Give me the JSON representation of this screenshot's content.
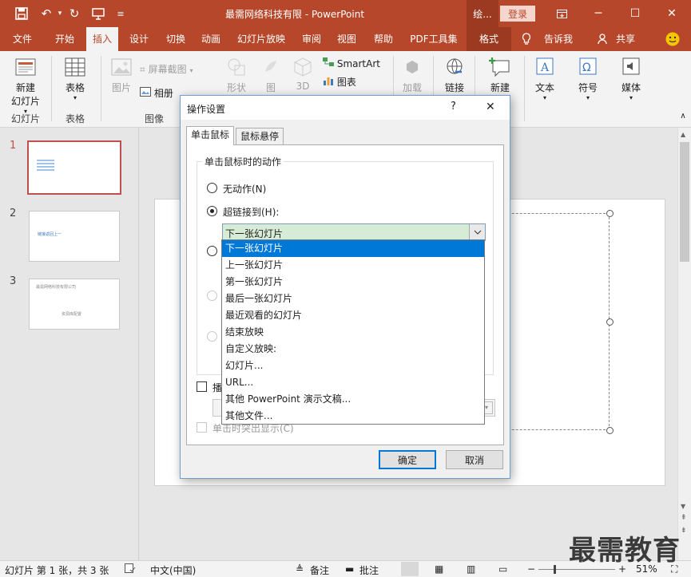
{
  "titlebar": {
    "title": "最需网络科技有限 - PowerPoint",
    "context_tab": "绘...",
    "login": "登录"
  },
  "tabs": [
    "文件",
    "开始",
    "插入",
    "设计",
    "切换",
    "动画",
    "幻灯片放映",
    "审阅",
    "视图",
    "帮助",
    "PDF工具集",
    "格式"
  ],
  "tell_me": "告诉我",
  "share": "共享",
  "ribbon": {
    "new_slide": "新建\n幻灯片",
    "new_slide_l1": "新建",
    "new_slide_l2": "幻灯片",
    "table": "表格",
    "images": "图片",
    "screenshot": "屏幕截图",
    "album": "相册",
    "shapes": "形状",
    "icons": "图",
    "model3d": "3D",
    "smartart": "SmartArt",
    "chart": "图表",
    "addins": "加载",
    "link": "链接",
    "comment": "新建",
    "text": "文本",
    "symbol": "符号",
    "media": "媒体",
    "group_slides": "幻灯片",
    "group_tables": "表格",
    "group_images": "图像"
  },
  "thumbnails": [
    {
      "num": "1",
      "text": ""
    },
    {
      "num": "2",
      "text": "链接返回上一"
    },
    {
      "num": "3",
      "text": "最需网络科技有限公司",
      "sub": "资源库配置"
    }
  ],
  "dialog": {
    "title": "操作设置",
    "help": "?",
    "close": "✕",
    "tab_click": "单击鼠标",
    "tab_hover": "鼠标悬停",
    "group_label": "单击鼠标时的动作",
    "opt_none": "无动作(N)",
    "opt_hyperlink": "超链接到(H):",
    "combo_value": "下一张幻灯片",
    "play_sound_label": "播",
    "highlight_label": "单击时突出显示(C)",
    "ok": "确定",
    "cancel": "取消"
  },
  "dropdown_items": [
    "下一张幻灯片",
    "上一张幻灯片",
    "第一张幻灯片",
    "最后一张幻灯片",
    "最近观看的幻灯片",
    "结束放映",
    "自定义放映:",
    "幻灯片...",
    "URL...",
    "其他 PowerPoint 演示文稿...",
    "其他文件..."
  ],
  "status": {
    "slide_info": "幻灯片 第 1 张，共 3 张",
    "language": "中文(中国)",
    "notes": "备注",
    "comments": "批注",
    "zoom": "51%"
  },
  "watermark": "最需教育",
  "colors": {
    "accent": "#b7472a",
    "highlight": "#0078d7"
  }
}
